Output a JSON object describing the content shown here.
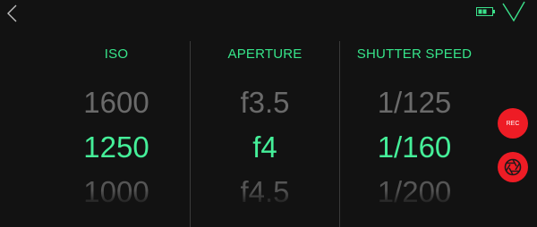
{
  "header": {
    "back_icon": "chevron-left-icon",
    "battery_icon": "battery-icon",
    "done_icon": "checkmark-icon"
  },
  "columns": [
    {
      "label": "ISO",
      "values": [
        "1600",
        "1250",
        "1000"
      ],
      "selected_index": 1
    },
    {
      "label": "APERTURE",
      "values": [
        "f3.5",
        "f4",
        "f4.5"
      ],
      "selected_index": 1
    },
    {
      "label": "SHUTTER SPEED",
      "values": [
        "1/125",
        "1/160",
        "1/200"
      ],
      "selected_index": 1
    }
  ],
  "buttons": {
    "rec_label": "REC",
    "shutter_icon": "aperture-icon"
  },
  "colors": {
    "accent": "#45ef99",
    "record": "#ee1c25",
    "background": "#121212"
  }
}
